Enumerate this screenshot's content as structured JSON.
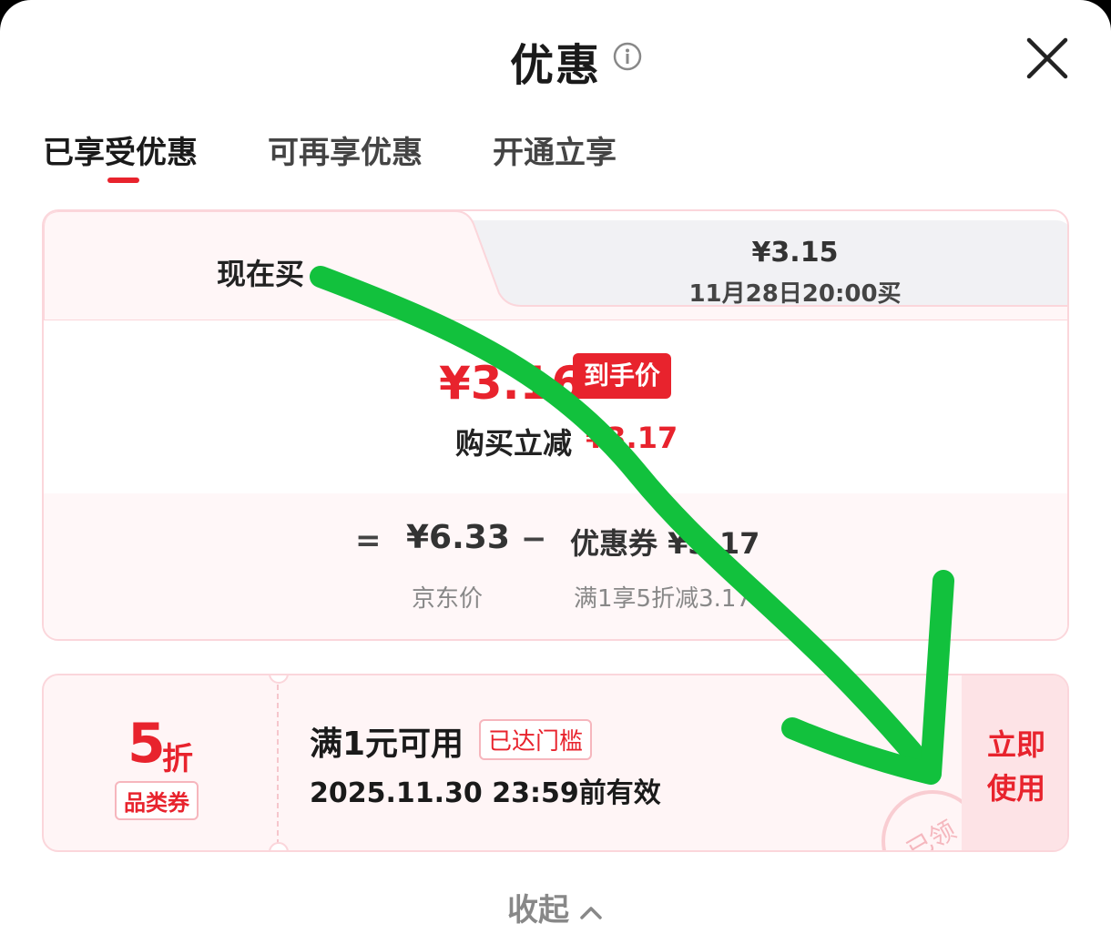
{
  "header": {
    "title": "优惠"
  },
  "tabs": [
    {
      "label": "已享受优惠",
      "active": true
    },
    {
      "label": "可再享优惠",
      "active": false
    },
    {
      "label": "开通立享",
      "active": false
    }
  ],
  "price_card": {
    "buy_now_label": "现在买",
    "buy_later_price": "¥3.15",
    "buy_later_time": "11月28日20:00买",
    "final_price": "¥3.16",
    "final_price_badge": "到手价",
    "reduce_label": "购买立减",
    "reduce_amount": "¥3.17",
    "calc_eq": "=",
    "jd_price": "¥6.33",
    "calc_minus": "−",
    "coupon_label": "优惠券 ¥3.17",
    "jd_price_caption": "京东价",
    "coupon_caption": "满1享5折减3.17"
  },
  "coupon": {
    "discount_value": "5",
    "discount_unit": "折",
    "type": "品类券",
    "condition": "满1元可用",
    "reached_badge": "已达门槛",
    "expire": "2025.11.30 23:59前有效",
    "use_now_label": "立即使用",
    "claimed_stamp": "已领"
  },
  "footer": {
    "collapse_label": "收起"
  },
  "colors": {
    "accent": "#e8232d",
    "annotation_arrow": "#0fc43a"
  },
  "icons": {
    "info": "info-icon",
    "close": "close-icon",
    "collapse": "chevron-up-icon"
  }
}
